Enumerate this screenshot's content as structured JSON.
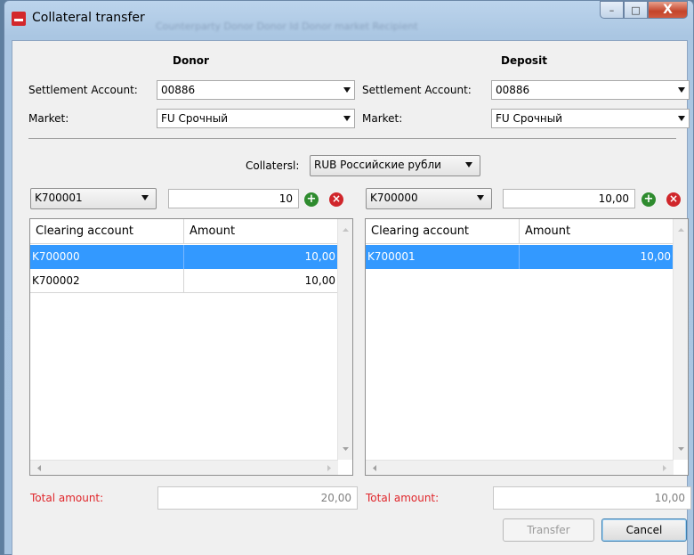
{
  "window": {
    "title": "Collateral transfer",
    "ghost_text": "Counterparty   Donor   Donor Id   Donor market   Recipient"
  },
  "donor": {
    "heading": "Donor",
    "settlement_label": "Settlement Account:",
    "settlement_value": "00886",
    "market_label": "Market:",
    "market_value": "FU Срочный",
    "account_select": "K700001",
    "amount_input": "10",
    "table": {
      "col_account": "Clearing account",
      "col_amount": "Amount",
      "rows": [
        {
          "account": "K700000",
          "amount": "10,00"
        },
        {
          "account": "K700002",
          "amount": "10,00"
        }
      ]
    },
    "total_label": "Total amount:",
    "total_value": "20,00"
  },
  "deposit": {
    "heading": "Deposit",
    "settlement_label": "Settlement Account:",
    "settlement_value": "00886",
    "market_label": "Market:",
    "market_value": "FU Срочный",
    "account_select": "K700000",
    "amount_input": "10,00",
    "table": {
      "col_account": "Clearing account",
      "col_amount": "Amount",
      "rows": [
        {
          "account": "K700001",
          "amount": "10,00"
        }
      ]
    },
    "total_label": "Total amount:",
    "total_value": "10,00"
  },
  "collateral": {
    "label": "Collatersl:",
    "value": "RUB Российские рубли"
  },
  "buttons": {
    "transfer": "Transfer",
    "cancel": "Cancel"
  },
  "icons": {
    "add": "plus-circle-icon",
    "remove": "x-circle-icon",
    "add_glyph": "+",
    "remove_glyph": "×",
    "minimize_glyph": "–",
    "maximize_glyph": "□",
    "close_glyph": "X"
  },
  "colors": {
    "selection": "#3399ff",
    "total_label": "#e0262b",
    "add_icon": "#2e8b2e",
    "remove_icon": "#d0262b"
  }
}
